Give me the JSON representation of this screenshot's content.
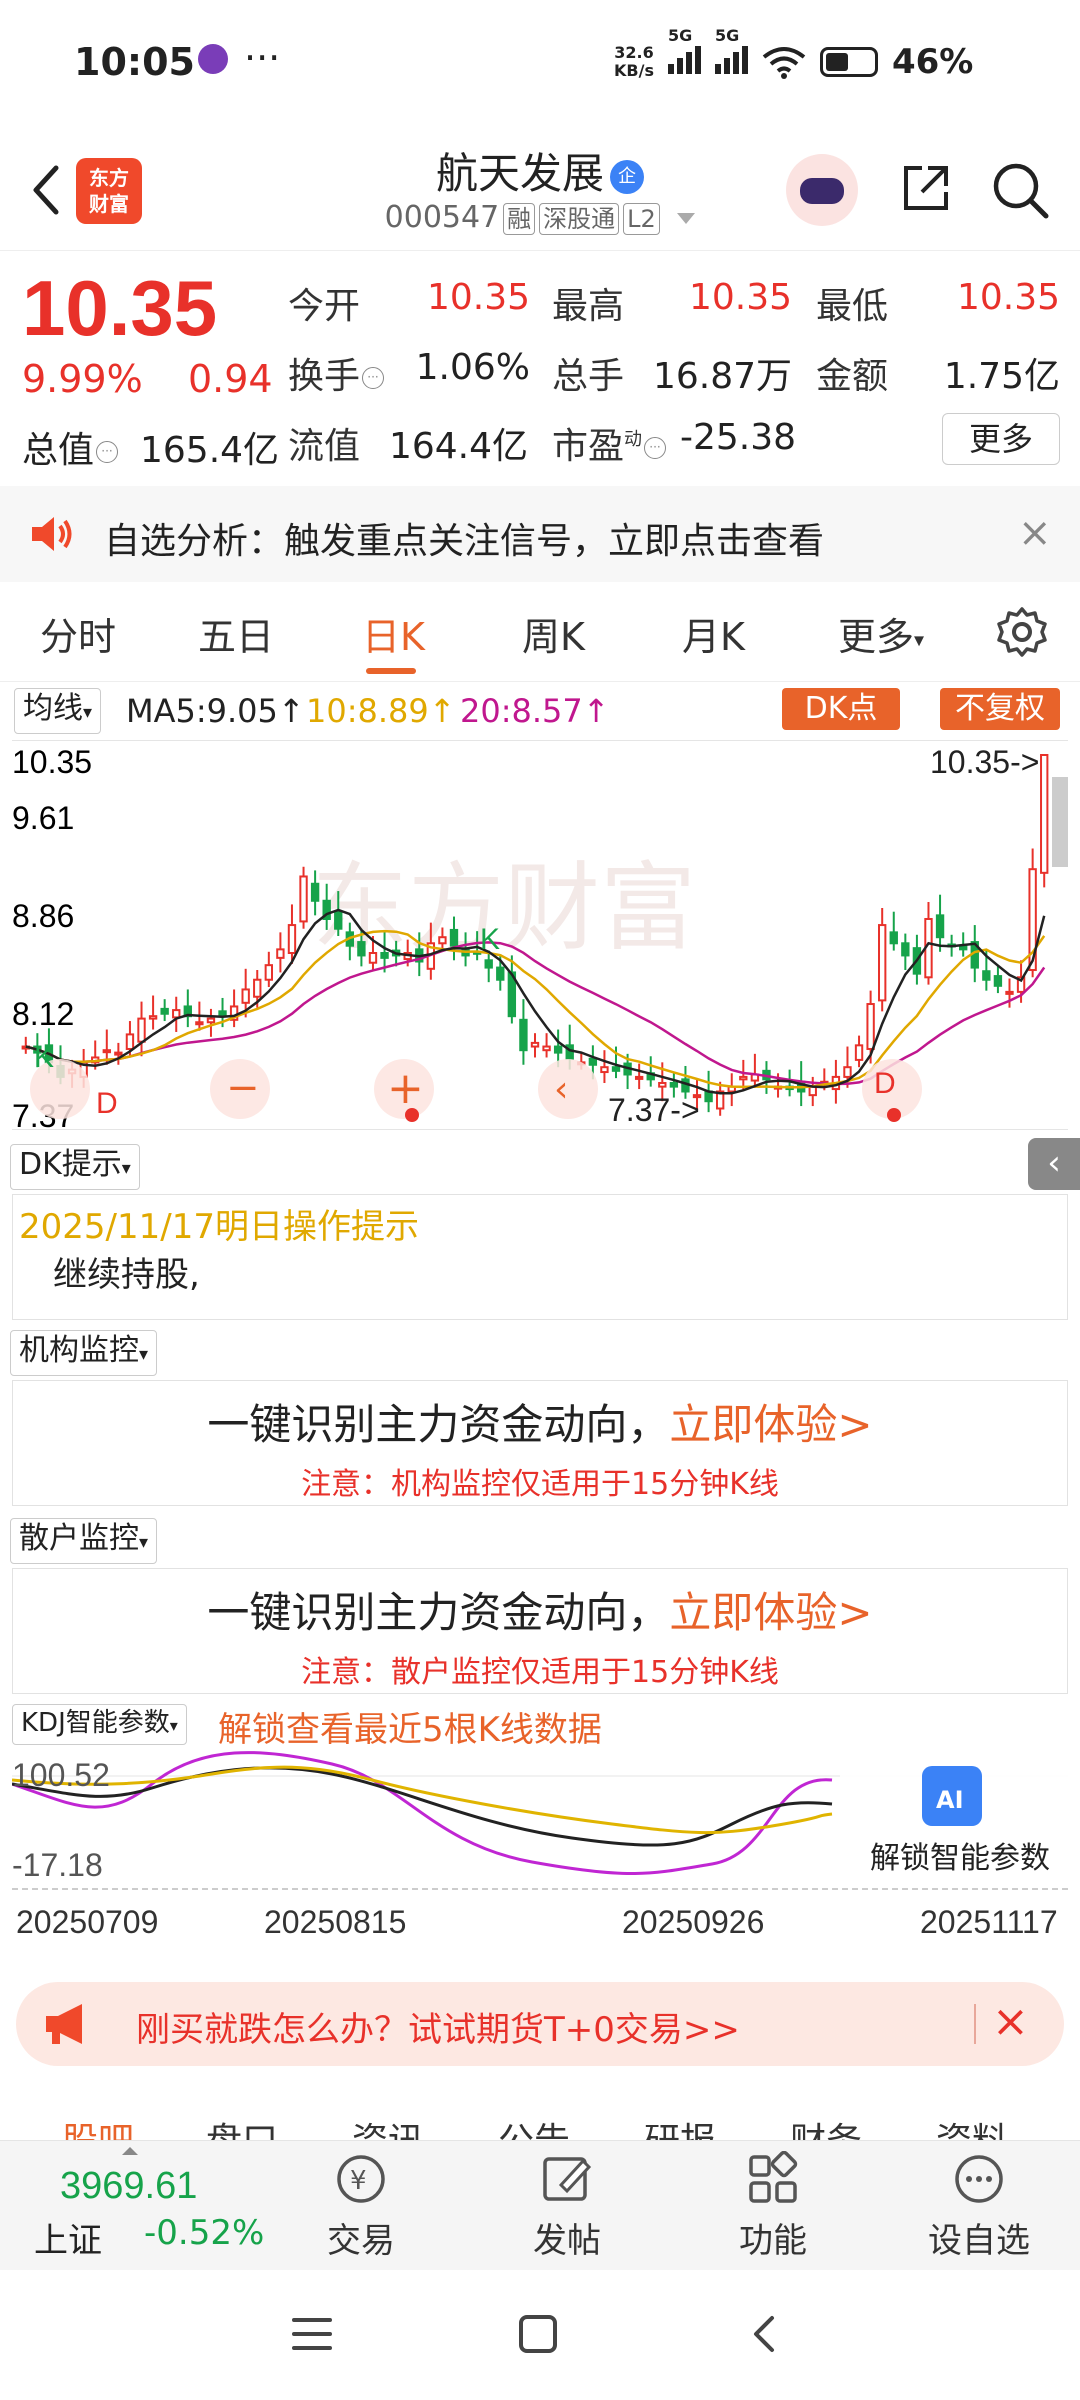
{
  "status_bar": {
    "time": "10:05",
    "more": "···",
    "net_speed_value": "32.6",
    "net_speed_unit": "KB/s",
    "sim1": "5G",
    "sim2": "5G",
    "battery": "46%"
  },
  "header": {
    "logo_line1": "东方",
    "logo_line2": "财富",
    "stock_name": "航天发展",
    "badge": "企",
    "code": "000547",
    "tags": [
      "融",
      "深股通",
      "L2"
    ]
  },
  "quote": {
    "price": "10.35",
    "change_pct": "9.99%",
    "change_val": "0.94",
    "open_label": "今开",
    "open": "10.35",
    "high_label": "最高",
    "high": "10.35",
    "low_label": "最低",
    "low": "10.35",
    "turnover_label": "换手",
    "turnover": "1.06%",
    "volume_label": "总手",
    "volume": "16.87万",
    "amount_label": "金额",
    "amount": "1.75亿",
    "total_cap_label": "总值",
    "total_cap": "165.4亿",
    "float_cap_label": "流值",
    "float_cap": "164.4亿",
    "pe_label": "市盈",
    "pe_sup": "动",
    "pe": "-25.38",
    "more_button": "更多"
  },
  "alert": {
    "text": "自选分析：触发重点关注信号，立即点击查看",
    "close": "×"
  },
  "tabs": [
    "分时",
    "五日",
    "日K",
    "周K",
    "月K",
    "更多"
  ],
  "active_tab": "日K",
  "ma": {
    "selector": "均线",
    "ma5": "MA5:9.05",
    "ma10": "10:8.89",
    "ma20": "20:8.57",
    "dk_button": "DK点",
    "fq_button": "不复权",
    "colors": {
      "ma5": "#222222",
      "ma10": "#e0a800",
      "ma20": "#c0178e"
    }
  },
  "chart_data": {
    "type": "candlestick",
    "y_ticks": [
      "10.35",
      "9.61",
      "8.86",
      "8.12",
      "7.37"
    ],
    "ylim": [
      7.37,
      10.35
    ],
    "last_price_label": "10.35->",
    "low_label": "7.37->",
    "markers": [
      "K",
      "D",
      "K",
      "D"
    ],
    "approx_close": [
      7.95,
      7.9,
      7.82,
      7.7,
      7.76,
      7.82,
      7.86,
      7.92,
      7.9,
      8.05,
      8.18,
      8.2,
      8.22,
      8.25,
      8.2,
      8.15,
      8.18,
      8.2,
      8.28,
      8.42,
      8.5,
      8.62,
      8.75,
      8.95,
      9.35,
      9.15,
      9.0,
      8.92,
      8.78,
      8.7,
      8.72,
      8.68,
      8.7,
      8.72,
      8.65,
      8.8,
      8.85,
      8.78,
      8.7,
      8.72,
      8.6,
      8.5,
      8.2,
      7.92,
      7.98,
      7.95,
      7.9,
      7.85,
      7.82,
      7.8,
      7.78,
      7.75,
      7.72,
      7.7,
      7.68,
      7.65,
      7.62,
      7.58,
      7.55,
      7.5,
      7.58,
      7.62,
      7.7,
      7.72,
      7.68,
      7.62,
      7.6,
      7.58,
      7.62,
      7.66,
      7.7,
      7.78,
      7.96,
      8.3,
      8.95,
      8.8,
      8.7,
      8.55,
      9.0,
      8.85,
      8.78,
      8.75,
      8.6,
      8.5,
      8.45,
      8.4,
      8.52,
      9.41,
      10.35
    ]
  },
  "dk_panel": {
    "title": "DK提示",
    "date_line": "2025/11/17明日操作提示",
    "advice": "继续持股,"
  },
  "inst_panel": {
    "title": "机构监控",
    "main_text": "一键识别主力资金动向，",
    "link_text": "立即体验>",
    "note": "注意：机构监控仅适用于15分钟K线"
  },
  "retail_panel": {
    "title": "散户监控",
    "main_text": "一键识别主力资金动向，",
    "link_text": "立即体验>",
    "note": "注意：散户监控仅适用于15分钟K线"
  },
  "kdj": {
    "selector": "KDJ智能参数",
    "unlock_text": "解锁查看最近5根K线数据",
    "y_top": "100.52",
    "y_bottom": "-17.18",
    "unlock_button": "解锁智能参数",
    "ai_badge": "AI"
  },
  "dates": [
    "20250709",
    "20250815",
    "20250926",
    "20251117"
  ],
  "futures_banner": {
    "text": "刚买就跌怎么办？试试期货T+0交易>>",
    "close": "×"
  },
  "subnav": [
    "股吧",
    "盘口",
    "资讯",
    "公告",
    "研报",
    "财务",
    "资料"
  ],
  "bottom_bar": {
    "index_value": "3969.61",
    "index_name": "上证",
    "index_change": "-0.52%",
    "trade": "交易",
    "post": "发帖",
    "functions": "功能",
    "add_watch": "设自选"
  }
}
